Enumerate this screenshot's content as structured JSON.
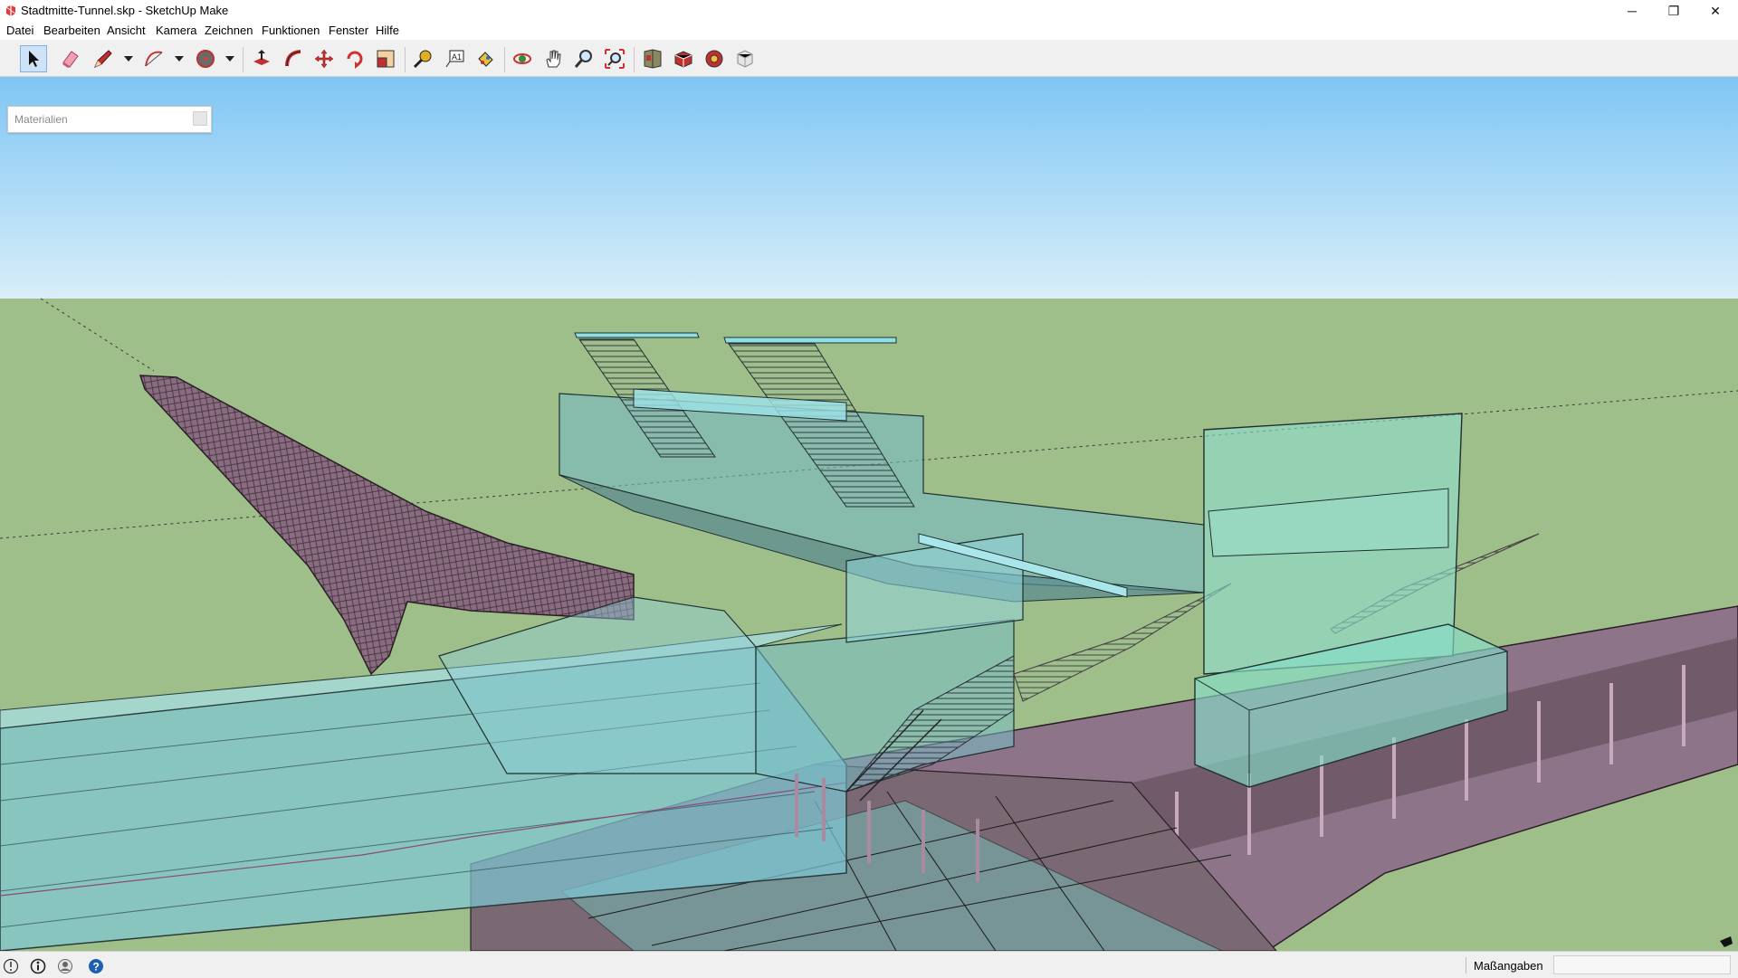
{
  "window": {
    "title": "Stadtmitte-Tunnel.skp - SketchUp Make",
    "minimize_glyph": "─",
    "restore_glyph": "❐",
    "close_glyph": "✕"
  },
  "menu": [
    {
      "name": "menu-datei",
      "label": "Datei"
    },
    {
      "name": "menu-bearbeiten",
      "label": "Bearbeiten"
    },
    {
      "name": "menu-ansicht",
      "label": "Ansicht"
    },
    {
      "name": "menu-kamera",
      "label": "Kamera"
    },
    {
      "name": "menu-zeichnen",
      "label": "Zeichnen"
    },
    {
      "name": "menu-funktionen",
      "label": "Funktionen"
    },
    {
      "name": "menu-fenster",
      "label": "Fenster"
    },
    {
      "name": "menu-hilfe",
      "label": "Hilfe"
    }
  ],
  "toolbar": {
    "active_tool": "select",
    "tools": [
      "select",
      "eraser",
      "line",
      "arc",
      "circle",
      "push-pull",
      "follow-me",
      "move",
      "rotate",
      "scale",
      "tape-measure",
      "text",
      "paint-bucket",
      "orbit",
      "pan",
      "zoom",
      "zoom-extents",
      "warehouse",
      "extension-warehouse",
      "layout-send",
      "add-location"
    ]
  },
  "materials_panel": {
    "title": "Materialien"
  },
  "status": {
    "measure_label": "Maßangaben",
    "measure_value": ""
  },
  "colors": {
    "sky_top": "#7fc6f4",
    "sky_bottom": "#d9eef9",
    "ground": "#9ebf8a",
    "glass": "#7fd8e0",
    "tunnel": "#8a6c80",
    "accent": "#e33b3b"
  }
}
